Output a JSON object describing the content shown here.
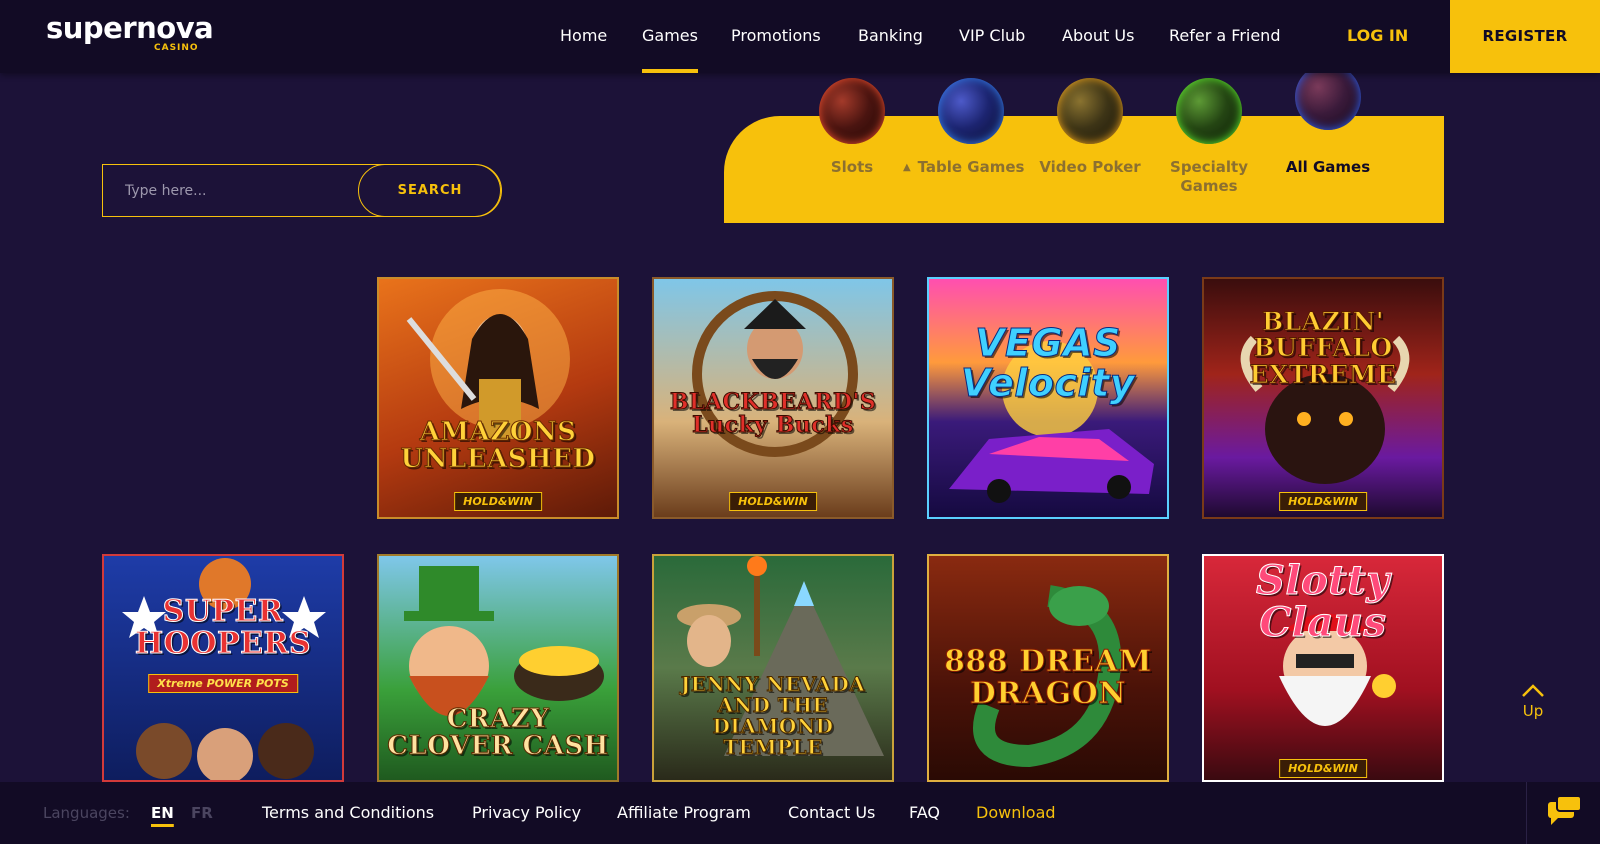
{
  "brand": {
    "name": "supernova",
    "sub": "CASINO"
  },
  "nav": {
    "items": [
      "Home",
      "Games",
      "Promotions",
      "Banking",
      "VIP Club",
      "About Us",
      "Refer a Friend"
    ],
    "active": "Games",
    "login": "LOG IN",
    "register": "REGISTER"
  },
  "search": {
    "placeholder": "Type here...",
    "button": "SEARCH"
  },
  "categories": {
    "items": [
      {
        "label": "Slots",
        "orb": "red-orb"
      },
      {
        "label": "Table Games",
        "orb": "blue-orb"
      },
      {
        "label": "Video Poker",
        "orb": "gold-orb"
      },
      {
        "label": "Specialty Games",
        "orb": "green-orb"
      },
      {
        "label": "All Games",
        "orb": "crimson-orb"
      }
    ],
    "active": "All Games"
  },
  "games": [
    {
      "title": "AMAZONS UNLEASHED",
      "badge": "HOLD&WIN"
    },
    {
      "title": "BLACKBEARD'S Lucky Bucks",
      "badge": "HOLD&WIN"
    },
    {
      "title": "VEGAS Velocity",
      "badge": ""
    },
    {
      "title": "BLAZIN' BUFFALO EXTREME",
      "badge": "HOLD&WIN"
    },
    {
      "title": "SUPER HOOPERS",
      "badge": "Xtreme POWER POTS"
    },
    {
      "title": "CRAZY CLOVER CASH",
      "badge": ""
    },
    {
      "title": "JENNY NEVADA AND THE DIAMOND TEMPLE",
      "badge": ""
    },
    {
      "title": "888 DREAM DRAGON",
      "badge": ""
    },
    {
      "title": "Slotty Claus",
      "badge": "HOLD&WIN"
    }
  ],
  "up": {
    "label": "Up"
  },
  "footer": {
    "languages_label": "Languages:",
    "languages": [
      "EN",
      "FR"
    ],
    "active_language": "EN",
    "links": [
      "Terms and Conditions",
      "Privacy Policy",
      "Affiliate Program",
      "Contact Us",
      "FAQ",
      "Download"
    ]
  },
  "colors": {
    "accent": "#f7c10c",
    "background": "#1c1238",
    "header": "#120b25"
  }
}
